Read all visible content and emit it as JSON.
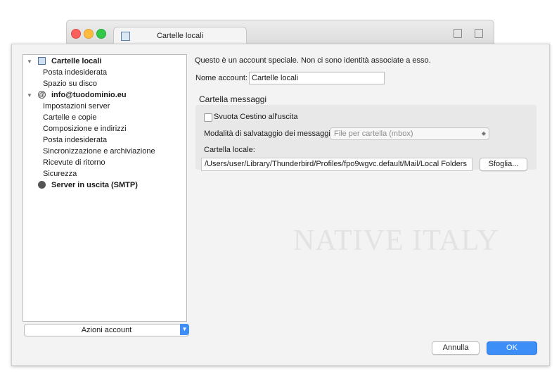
{
  "window": {
    "tab_title": "Cartelle locali"
  },
  "tree": {
    "accounts": [
      {
        "name": "Cartelle locali",
        "icon": "local-folders-icon",
        "children": [
          "Posta indesiderata",
          "Spazio su disco"
        ]
      },
      {
        "name": "info@tuodominio.eu",
        "icon": "email-account-icon",
        "children": [
          "Impostazioni server",
          "Cartelle e copie",
          "Composizione e indirizzi",
          "Posta indesiderata",
          "Sincronizzazione e archiviazione",
          "Ricevute di ritorno",
          "Sicurezza"
        ]
      },
      {
        "name": "Server in uscita (SMTP)",
        "icon": "smtp-server-icon",
        "children": []
      }
    ],
    "actions_label": "Azioni account"
  },
  "content": {
    "note": "Questo è un account speciale. Non ci sono identità associate a esso.",
    "account_name_label": "Nome account:",
    "account_name_value": "Cartelle locali",
    "section_title": "Cartella messaggi",
    "empty_trash_label": "Svuota Cestino all'uscita",
    "empty_trash_checked": false,
    "storage_mode_label": "Modalità di salvataggio dei messaggi:",
    "storage_mode_value": "File per cartella (mbox)",
    "local_folder_label": "Cartella locale:",
    "local_folder_path": "/Users/user/Library/Thunderbird/Profiles/fpo9wgvc.default/Mail/Local Folders",
    "browse_label": "Sfoglia..."
  },
  "watermark": "NATIVE ITALY",
  "footer": {
    "cancel_label": "Annulla",
    "ok_label": "OK"
  }
}
